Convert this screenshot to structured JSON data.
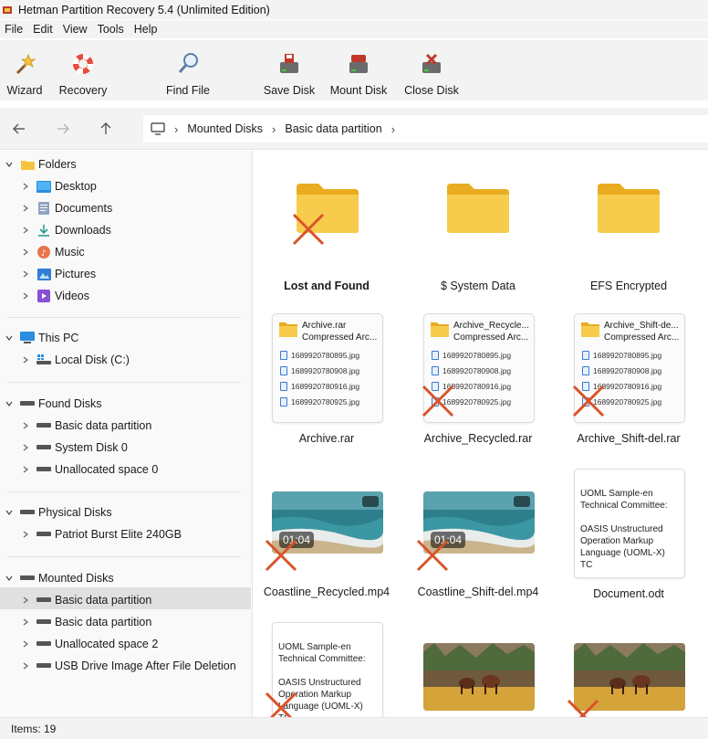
{
  "window": {
    "title": "Hetman Partition Recovery 5.4 (Unlimited Edition)"
  },
  "menu": [
    "File",
    "Edit",
    "View",
    "Tools",
    "Help"
  ],
  "toolbar": {
    "wizard": "Wizard",
    "recovery": "Recovery",
    "find_file": "Find File",
    "save_disk": "Save Disk",
    "mount_disk": "Mount Disk",
    "close_disk": "Close Disk"
  },
  "breadcrumb": [
    "Mounted Disks",
    "Basic data partition"
  ],
  "sidebar": {
    "folders": {
      "label": "Folders",
      "items": [
        "Desktop",
        "Documents",
        "Downloads",
        "Music",
        "Pictures",
        "Videos"
      ]
    },
    "this_pc": {
      "label": "This PC",
      "items": [
        "Local Disk (C:)"
      ]
    },
    "found_disks": {
      "label": "Found Disks",
      "items": [
        "Basic data partition",
        "System Disk 0",
        "Unallocated space 0"
      ]
    },
    "physical_disks": {
      "label": "Physical Disks",
      "items": [
        "Patriot Burst Elite 240GB"
      ]
    },
    "mounted_disks": {
      "label": "Mounted Disks",
      "items": [
        "Basic data partition",
        "Basic data partition",
        "Unallocated space 2",
        "USB Drive Image After File Deletion"
      ]
    }
  },
  "content": {
    "folders": [
      {
        "name": "Lost and Found",
        "deleted": true
      },
      {
        "name": "$ System Data",
        "deleted": false
      },
      {
        "name": "EFS Encrypted",
        "deleted": false
      }
    ],
    "archives": [
      {
        "name": "Archive.rar",
        "card_title": "Archive.rar",
        "card_subtitle": "Compressed Arc...",
        "files": [
          "1689920780895.jpg",
          "1689920780908.jpg",
          "1689920780916.jpg",
          "1689920780925.jpg"
        ],
        "deleted": false
      },
      {
        "name": "Archive_Recycled.rar",
        "card_title": "Archive_Recycle...",
        "card_subtitle": "Compressed Arc...",
        "files": [
          "1689920780895.jpg",
          "1689920780908.jpg",
          "1689920780916.jpg",
          "1689920780925.jpg"
        ],
        "deleted": true
      },
      {
        "name": "Archive_Shift-del.rar",
        "card_title": "Archive_Shift-de...",
        "card_subtitle": "Compressed Arc...",
        "files": [
          "1689920780895.jpg",
          "1689920780908.jpg",
          "1689920780916.jpg",
          "1689920780925.jpg"
        ],
        "deleted": true
      }
    ],
    "videos": [
      {
        "name": "Coastline_Recycled.mp4",
        "duration": "01:04",
        "deleted": true
      },
      {
        "name": "Coastline_Shift-del.mp4",
        "duration": "01:04",
        "deleted": true
      }
    ],
    "document": {
      "name": "Document.odt",
      "lines": [
        "UOML Sample-en",
        "Technical Committee:",
        "",
        "OASIS Unstructured",
        "Operation Markup",
        "Language (UOML-X) TC"
      ]
    },
    "document2": {
      "lines": [
        "UOML Sample-en",
        "Technical Committee:",
        "",
        "OASIS Unstructured",
        "Operation Markup",
        "Language (UOML-X) TC"
      ],
      "deleted": true
    }
  },
  "status": {
    "items": "Items: 19"
  },
  "colors": {
    "folder": "#f5c43c",
    "delete_mark": "#d9542a",
    "selection": "#e0e0e0"
  }
}
